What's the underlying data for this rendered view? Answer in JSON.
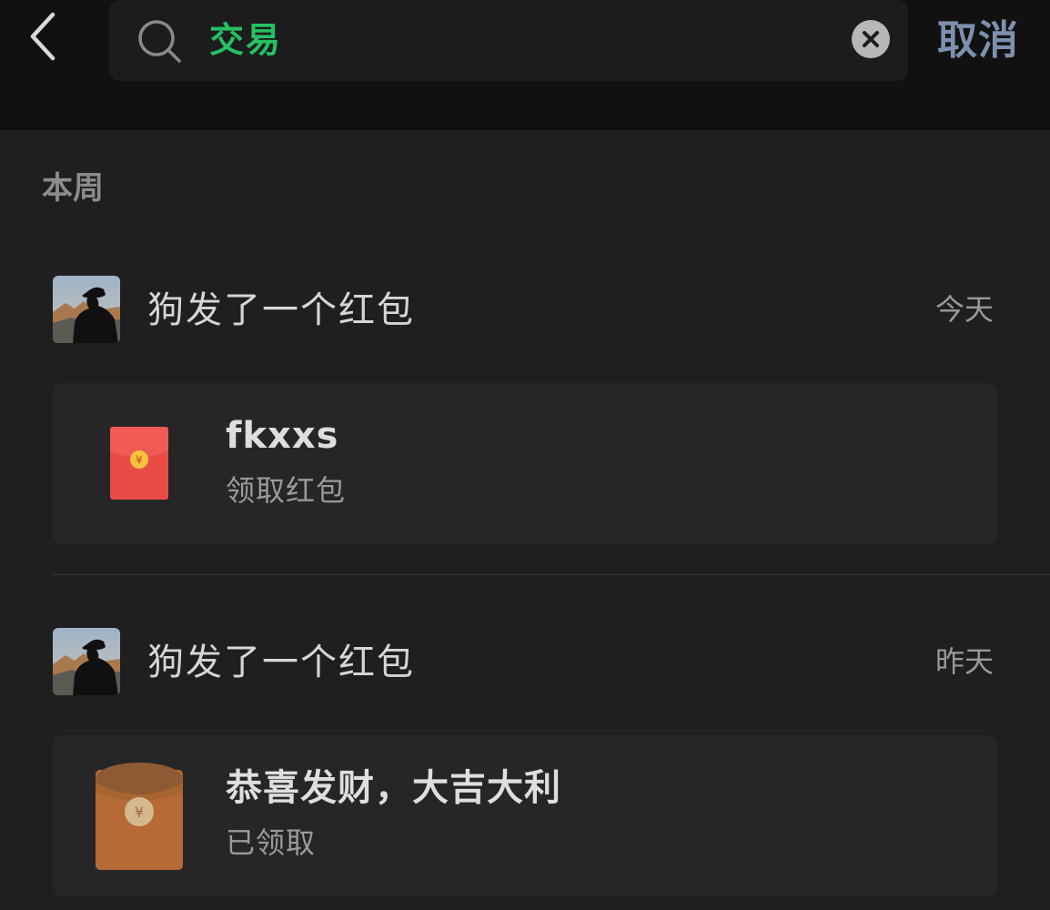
{
  "header": {
    "back_icon": "chevron-left-icon",
    "search_icon": "search-icon",
    "search_query": "交易",
    "clear_icon": "close-icon",
    "cancel_label": "取消"
  },
  "section": {
    "title": "本周"
  },
  "items": [
    {
      "title": "狗发了一个红包",
      "date": "今天",
      "card": {
        "icon": "red-packet-icon",
        "title": "fkxxs",
        "subtitle": "领取红包"
      }
    },
    {
      "title": "狗发了一个红包",
      "date": "昨天",
      "card": {
        "icon": "opened-red-packet-icon",
        "title": "恭喜发财，大吉大利",
        "subtitle": "已领取"
      }
    }
  ],
  "colors": {
    "accent_green": "#25c063",
    "cancel_blue": "#7d91ae",
    "red_packet": "#e84c47",
    "opened_packet": "#b66a36"
  }
}
